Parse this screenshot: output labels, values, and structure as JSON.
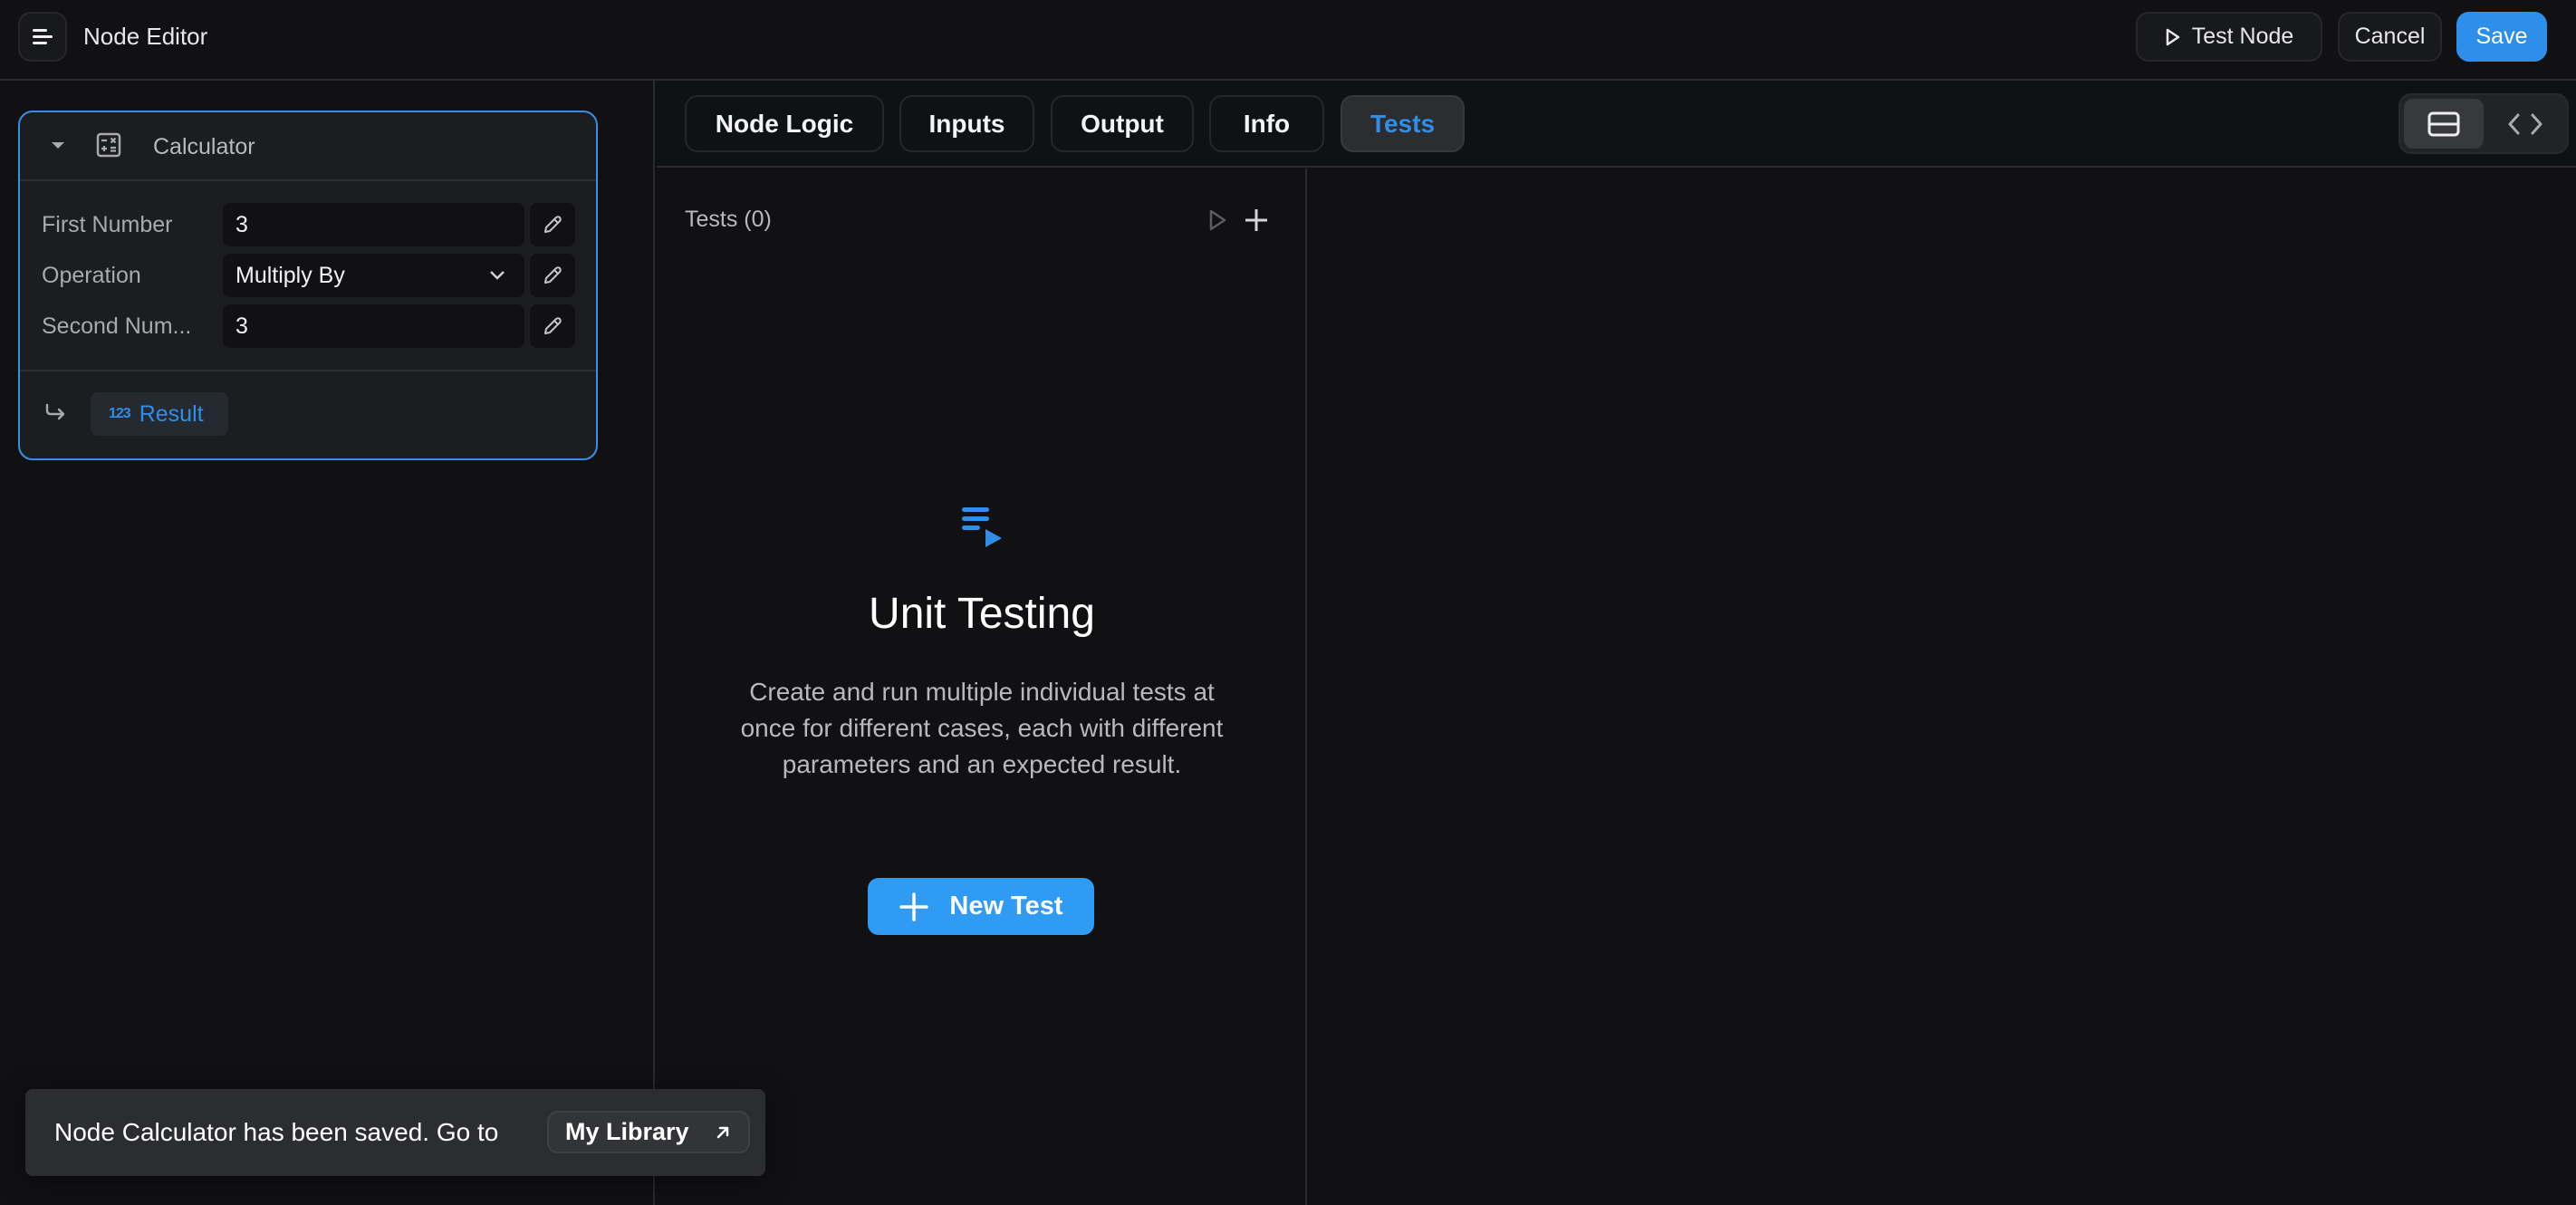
{
  "header": {
    "title": "Node Editor",
    "menu_icon": "hamburger-menu-icon",
    "test_node_label": "Test Node",
    "cancel_label": "Cancel",
    "save_label": "Save"
  },
  "node_card": {
    "title": "Calculator",
    "icon": "calculator-icon",
    "fields": [
      {
        "label": "First Number",
        "value": "3",
        "type": "number"
      },
      {
        "label": "Operation",
        "value": "Multiply By",
        "type": "select"
      },
      {
        "label": "Second Num...",
        "value": "3",
        "type": "number"
      }
    ],
    "output": {
      "type_badge": "123",
      "label": "Result"
    }
  },
  "tabs": [
    {
      "label": "Node Logic",
      "active": false
    },
    {
      "label": "Inputs",
      "active": false
    },
    {
      "label": "Output",
      "active": false
    },
    {
      "label": "Info",
      "active": false
    },
    {
      "label": "Tests",
      "active": true
    }
  ],
  "view_toggle": {
    "selected": "split-view",
    "options": [
      "split-view",
      "code-view"
    ]
  },
  "tests_panel": {
    "heading": "Tests (0)",
    "empty_state": {
      "title": "Unit Testing",
      "description": "Create and run multiple individual tests at once for different cases, each with different parameters and an expected result.",
      "button_label": "New Test"
    }
  },
  "toast": {
    "message": "Node Calculator has been saved. Go to",
    "link_label": "My Library"
  },
  "colors": {
    "accent": "#2d8fea",
    "background": "#111114",
    "card": "#1c1d21",
    "toast": "#2c2d30"
  }
}
